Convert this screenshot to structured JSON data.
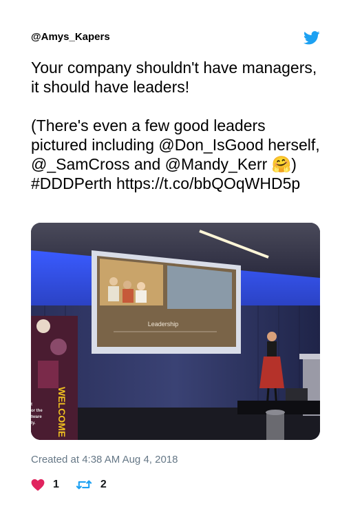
{
  "tweet": {
    "handle": "@Amys_Kapers",
    "text": "Your company shouldn't have managers, it should have leaders!\n\n(There's even a few good leaders pictured including @Don_IsGood herself, @_SamCross and @Mandy_Kerr 🤗) #DDDPerth https://t.co/bbQOqWHD5p",
    "timestamp": "Created at 4:38 AM Aug 4, 2018",
    "likes": "1",
    "retweets": "2",
    "media": {
      "slide_title": "Leadership",
      "banner_text": "WELCOME",
      "banner_small_text": [
        "t",
        "or the",
        "tware",
        "ty."
      ]
    }
  },
  "icons": {
    "brand": "twitter-bird-icon",
    "like": "heart-icon",
    "retweet": "retweet-icon"
  },
  "colors": {
    "twitter_blue": "#1DA1F2",
    "heart": "#E0245E",
    "retweet": "#17BF63",
    "muted": "#657786"
  }
}
